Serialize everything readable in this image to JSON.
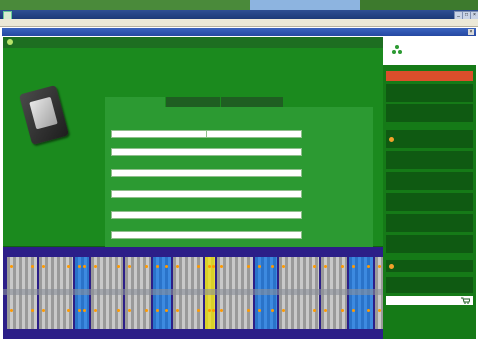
{
  "window": {
    "title": ""
  },
  "menu": {
    "items": [
      "",
      "",
      "",
      ""
    ]
  },
  "document": {
    "title": ""
  },
  "area": {
    "title": ""
  },
  "handwriting": {
    "lines": [
      "",
      "",
      "",
      ""
    ]
  },
  "form": {
    "tabs": [
      "",
      "",
      ""
    ],
    "rows": [
      {
        "label": "",
        "value": ""
      },
      {
        "label": "",
        "value": ""
      },
      {
        "label": "",
        "value": ""
      },
      {
        "label": "",
        "value": ""
      },
      {
        "label": "",
        "value": ""
      },
      {
        "label": "",
        "value": ""
      },
      {
        "label": "",
        "value": ""
      }
    ],
    "extra_label": "",
    "close_label": ""
  },
  "brand": {
    "name": ""
  },
  "sidebar": {
    "header": "",
    "items": [
      "",
      "",
      "",
      "",
      "",
      "",
      "",
      "",
      "",
      "",
      "",
      ""
    ],
    "basket": "",
    "footer": ""
  },
  "colors": {
    "app_green": "#1b8a1e",
    "nav_dark": "#0f5a12",
    "nav_header": "#dc4e2b",
    "diagram_bg": "#2c1e88"
  }
}
